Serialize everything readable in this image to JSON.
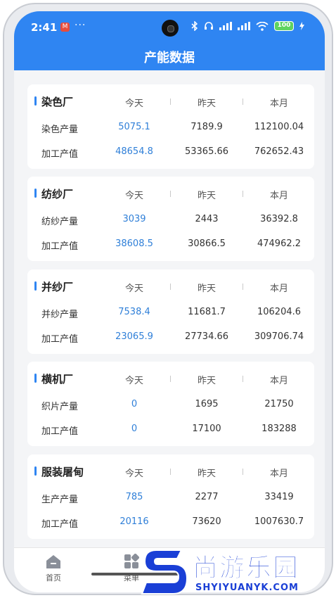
{
  "status_bar": {
    "time": "2:41",
    "notif_badge": "M",
    "more": "···",
    "battery": "100"
  },
  "page_title": "产能数据",
  "columns": {
    "today": "今天",
    "yesterday": "昨天",
    "month": "本月"
  },
  "factories": [
    {
      "name": "染色厂",
      "rows": [
        {
          "label": "染色产量",
          "today": "5075.1",
          "yesterday": "7189.9",
          "month": "112100.04"
        },
        {
          "label": "加工产值",
          "today": "48654.8",
          "yesterday": "53365.66",
          "month": "762652.43"
        }
      ]
    },
    {
      "name": "纺纱厂",
      "rows": [
        {
          "label": "纺纱产量",
          "today": "3039",
          "yesterday": "2443",
          "month": "36392.8"
        },
        {
          "label": "加工产值",
          "today": "38608.5",
          "yesterday": "30866.5",
          "month": "474962.2"
        }
      ]
    },
    {
      "name": "并纱厂",
      "rows": [
        {
          "label": "并纱产量",
          "today": "7538.4",
          "yesterday": "11681.7",
          "month": "106204.6"
        },
        {
          "label": "加工产值",
          "today": "23065.9",
          "yesterday": "27734.66",
          "month": "309706.74"
        }
      ]
    },
    {
      "name": "横机厂",
      "rows": [
        {
          "label": "织片产量",
          "today": "0",
          "yesterday": "1695",
          "month": "21750"
        },
        {
          "label": "加工产值",
          "today": "0",
          "yesterday": "17100",
          "month": "183288"
        }
      ]
    },
    {
      "name": "服装屠甸",
      "rows": [
        {
          "label": "生产产量",
          "today": "785",
          "yesterday": "2277",
          "month": "33419"
        },
        {
          "label": "加工产值",
          "today": "20116",
          "yesterday": "73620",
          "month": "1007630.7"
        }
      ]
    }
  ],
  "tabbar": {
    "home": "首页",
    "menu": "菜单"
  },
  "watermark": {
    "cn": "尚游乐园",
    "en": "SHYIYUANYK.COM"
  },
  "colors": {
    "primary": "#2f85f2",
    "today_value": "#2f7fd8",
    "watermark": "#1a3fd6"
  }
}
